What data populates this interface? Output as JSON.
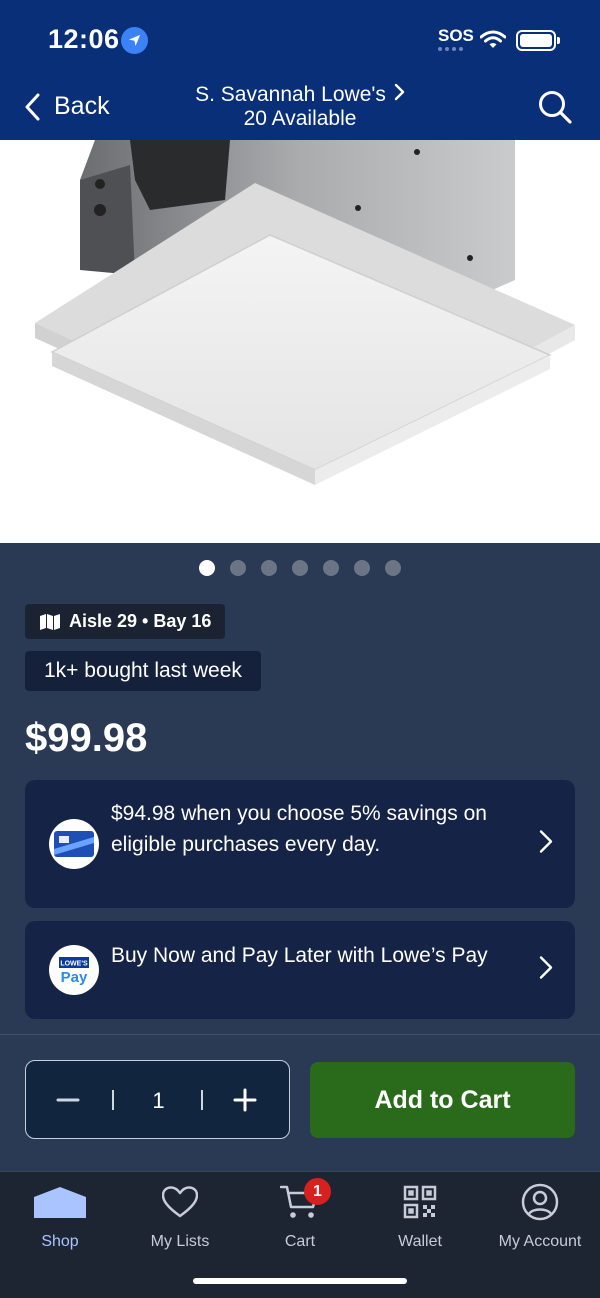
{
  "status_bar": {
    "time": "12:06",
    "sos": "SOS"
  },
  "nav": {
    "back_label": "Back",
    "store_name": "S. Savannah Lowe's",
    "availability": "20 Available"
  },
  "gallery": {
    "image_count": 7,
    "active_index": 0
  },
  "product": {
    "location": "Aisle 29 • Bay 16",
    "social_proof": "1k+ bought last week",
    "price": "$99.98"
  },
  "promos": [
    {
      "text": "$94.98 when you choose 5% savings on eligible purchases every day.",
      "icon": "lowes-card-icon"
    },
    {
      "text": "Buy Now and Pay Later with Lowe’s Pay",
      "icon": "lowes-pay-icon",
      "badge_text_top": "LOWE'S",
      "badge_text_bottom": "Pay"
    }
  ],
  "quantity": {
    "value": "1"
  },
  "add_to_cart_label": "Add to Cart",
  "tabs": [
    {
      "label": "Shop",
      "icon": "home-icon",
      "active": true
    },
    {
      "label": "My Lists",
      "icon": "heart-icon",
      "active": false
    },
    {
      "label": "Cart",
      "icon": "cart-icon",
      "active": false,
      "badge": "1"
    },
    {
      "label": "Wallet",
      "icon": "qr-icon",
      "active": false
    },
    {
      "label": "My Account",
      "icon": "account-icon",
      "active": false
    }
  ],
  "colors": {
    "header_blue": "#0a2f79",
    "body_bg": "#2a3a55",
    "promo_bg": "#152346",
    "add_to_cart_green": "#2a6b1b",
    "badge_red": "#d5211f",
    "active_tab": "#a9c4ff"
  }
}
